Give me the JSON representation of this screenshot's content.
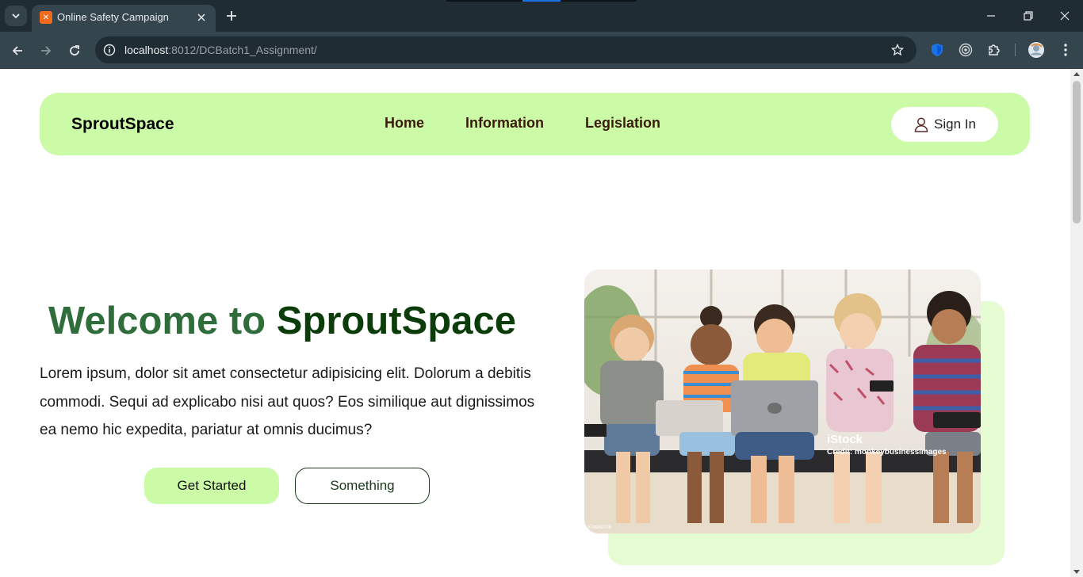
{
  "browser": {
    "tab": {
      "title": "Online Safety Campaign",
      "favicon": "xampp-icon"
    },
    "url": {
      "host": "localhost",
      "path": ":8012/DCBatch1_Assignment/"
    },
    "theme": {
      "frame": "#202c33",
      "toolbar": "#35454d"
    }
  },
  "site": {
    "brand": "SproutSpace",
    "nav": [
      {
        "label": "Home"
      },
      {
        "label": "Information"
      },
      {
        "label": "Legislation"
      }
    ],
    "signin_label": "Sign In",
    "accent": "#ccfba8"
  },
  "hero": {
    "title_part1": "Welcome to",
    "title_part2": "SproutSpace",
    "text": "Lorem ipsum, dolor sit amet consectetur adipisicing elit. Dolorum a debitis commodi. Sequi ad explicabo nisi aut quos? Eos similique aut dignissimos ea nemo hic expedita, pariatur at omnis ducimus?",
    "primary_button": "Get Started",
    "secondary_button": "Something",
    "image": {
      "watermark": "iStock",
      "credit": "Credit: monkeybusinessimages",
      "stock_id": "674969706"
    }
  }
}
